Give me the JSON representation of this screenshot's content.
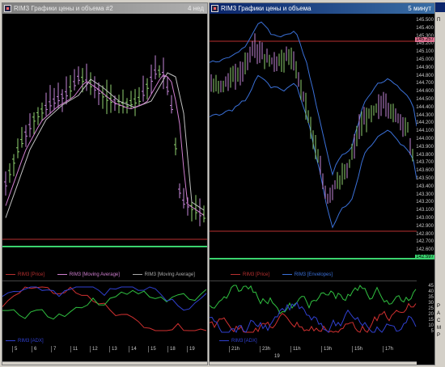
{
  "window_left": {
    "title": "RIM3 Графики цены и объема #2",
    "timeframe": "4 нед",
    "legend": [
      "RIM3 [Price]",
      "RIM3 [Moving Average]",
      "RIM3 [Moving Average]"
    ],
    "indicator_legend": "RIM3 [ADX]",
    "time_labels": [
      "5",
      "6",
      "7",
      "11",
      "12",
      "13",
      "14",
      "15",
      "18",
      "19"
    ]
  },
  "window_right": {
    "title": "RIM3 Графики цены и объема",
    "timeframe": "5 минут",
    "legend": [
      "RIM3 [Price]",
      "RIM3 [Envelopes]"
    ],
    "indicator_legend": "RIM3 [ADX]",
    "time_labels": [
      "21h",
      "23h",
      "11h",
      "13h",
      "15h",
      "17h"
    ],
    "date_label": "19",
    "price_axis": [
      "145.500",
      "145.400",
      "145.300",
      "145.200",
      "145.100",
      "145.000",
      "144.900",
      "144.800",
      "144.700",
      "144.600",
      "144.500",
      "144.400",
      "144.300",
      "144.200",
      "144.100",
      "144.000",
      "143.900",
      "143.800",
      "143.700",
      "143.600",
      "143.500",
      "143.400",
      "143.300",
      "143.200",
      "143.100",
      "143.000",
      "142.900",
      "142.800",
      "142.700",
      "142.600",
      "142.500"
    ],
    "upper_badge": "145.257",
    "lower_badge": "142.597",
    "adx_axis": [
      "45",
      "40",
      "35",
      "30",
      "25",
      "20",
      "15",
      "10",
      "5"
    ]
  },
  "side_panel": [
    "П",
    "Р",
    "А",
    "С",
    "М",
    "Р"
  ],
  "colors": {
    "candle_up": "#8fd16f",
    "candle_down": "#c486d8",
    "ma": "#d07fd0",
    "ma_alt": "#c0c0c0",
    "envelope": "#3a70d8",
    "support": "#3ad26e",
    "resistance": "#b83030",
    "adx_red": "#d03030",
    "adx_green": "#30c040",
    "adx_blue": "#3040d0"
  }
}
